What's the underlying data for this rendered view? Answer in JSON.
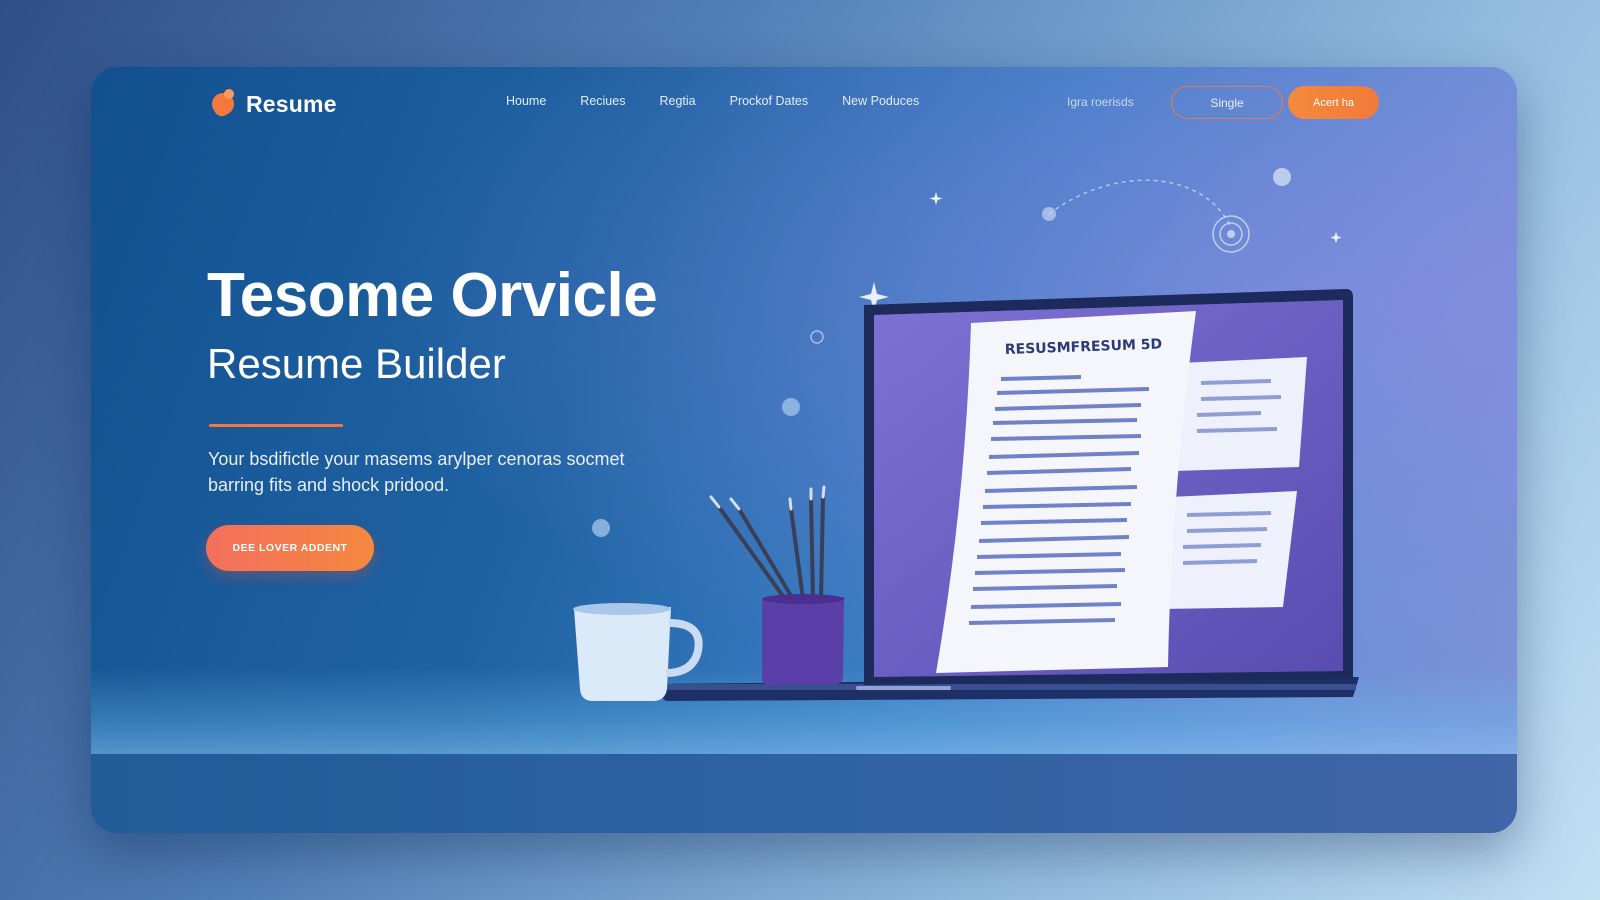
{
  "brand": {
    "name": "Resume"
  },
  "nav": {
    "links": [
      "Houme",
      "Reciues",
      "Regtia",
      "Prockof Dates",
      "New Poduces"
    ],
    "extra": "Igra roerisds",
    "outline_button": "Single",
    "fill_button": "Acert ha"
  },
  "hero": {
    "title": "Tesome Orvicle",
    "subtitle": "Resume Builder",
    "description": "Your bsdifictle your masems arylper cenoras socmet barring fits and shock pridood.",
    "cta": "DEE LOVER ADDENT"
  },
  "illustration": {
    "resume_heading": "RESUSMFRESUM 5D"
  },
  "colors": {
    "accent": "#f2793b",
    "card_bg": "#1f63a4",
    "laptop_screen": "#6a5fbf"
  }
}
